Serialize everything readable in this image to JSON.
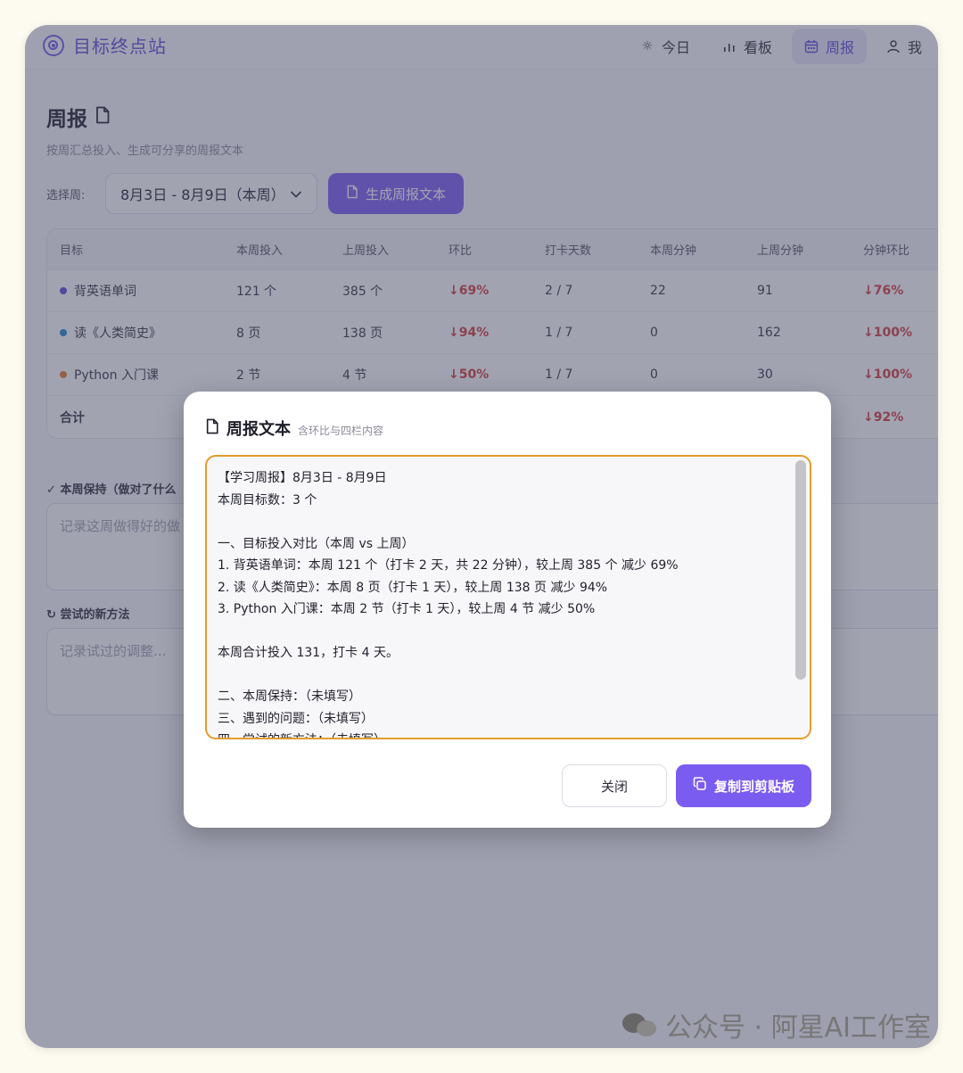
{
  "app": {
    "name": "目标终点站"
  },
  "nav": [
    {
      "icon": "sun-icon",
      "label": "今日",
      "active": false
    },
    {
      "icon": "bar-chart-icon",
      "label": "看板",
      "active": false
    },
    {
      "icon": "calendar-icon",
      "label": "周报",
      "active": true
    },
    {
      "icon": "user-icon",
      "label": "我",
      "active": false
    }
  ],
  "page": {
    "title": "周报",
    "subtitle": "按周汇总投入、生成可分享的周报文本",
    "week_label": "选择周:",
    "week_value": "8月3日 - 8月9日（本周）",
    "generate_label": "生成周报文本"
  },
  "table": {
    "headers": [
      "目标",
      "本周投入",
      "上周投入",
      "环比",
      "打卡天数",
      "本周分钟",
      "上周分钟",
      "分钟环比"
    ],
    "rows": [
      {
        "color": "#5b4ad8",
        "cells": [
          "背英语单词",
          "121 个",
          "385 个",
          "↓69%",
          "2 / 7",
          "22",
          "91",
          "↓76%"
        ]
      },
      {
        "color": "#1e88c8",
        "cells": [
          "读《人类简史》",
          "8 页",
          "138 页",
          "↓94%",
          "1 / 7",
          "0",
          "162",
          "↓100%"
        ]
      },
      {
        "color": "#e07a2e",
        "cells": [
          "Python 入门课",
          "2 节",
          "4 节",
          "↓50%",
          "1 / 7",
          "0",
          "30",
          "↓100%"
        ]
      }
    ],
    "total": {
      "label": "合计",
      "last": "↓92%"
    }
  },
  "sections": {
    "keep_label": "本周保持（做对了什么",
    "keep_placeholder": "记录这周做得好的做",
    "new_label": "尝试的新方法",
    "new_placeholder": "记录试过的调整..."
  },
  "modal": {
    "title": "周报文本",
    "subtitle": "含环比与四栏内容",
    "lines": [
      "【学习周报】8月3日 - 8月9日",
      "本周目标数：3 个",
      "",
      "一、目标投入对比（本周 vs 上周）",
      "1. 背英语单词：本周 121 个（打卡 2 天，共 22 分钟），较上周 385 个 减少 69%",
      "2. 读《人类简史》：本周 8 页（打卡 1 天），较上周 138 页 减少 94%",
      "3. Python 入门课：本周 2 节（打卡 1 天），较上周 4 节 减少 50%",
      "",
      "本周合计投入 131，打卡 4 天。",
      "",
      "二、本周保持：（未填写）",
      "三、遇到的问题：（未填写）",
      "四、尝试的新方法：（未填写）"
    ],
    "close_label": "关闭",
    "copy_label": "复制到剪贴板"
  },
  "watermark": "公众号 · 阿星AI工作室",
  "colors": {
    "accent": "#7b5cf0",
    "negative": "#d43a3a",
    "focus_border": "#e49c2c"
  }
}
